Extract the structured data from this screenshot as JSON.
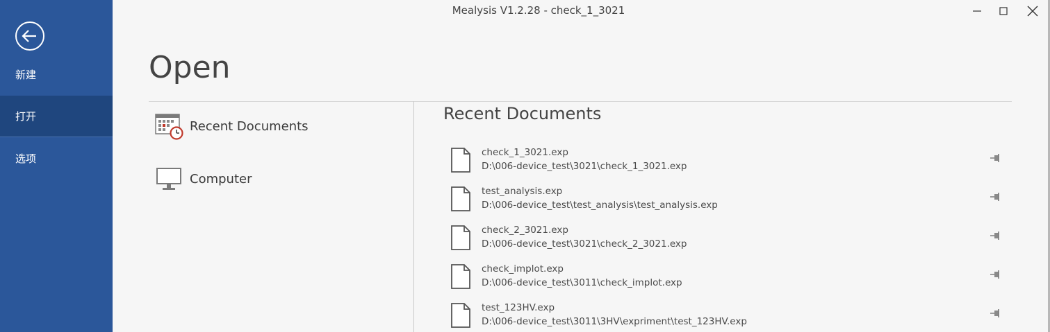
{
  "window": {
    "title": "Mealysis V1.2.28 - check_1_3021"
  },
  "sidebar": {
    "items": [
      {
        "label": "新建"
      },
      {
        "label": "打开"
      },
      {
        "label": "选项"
      }
    ]
  },
  "page": {
    "heading": "Open"
  },
  "places": [
    {
      "label": "Recent Documents",
      "icon": "recent-documents-icon"
    },
    {
      "label": "Computer",
      "icon": "computer-icon"
    }
  ],
  "recent": {
    "heading": "Recent Documents",
    "documents": [
      {
        "name": "check_1_3021.exp",
        "path": "D:\\006-device_test\\3021\\check_1_3021.exp"
      },
      {
        "name": "test_analysis.exp",
        "path": "D:\\006-device_test\\test_analysis\\test_analysis.exp"
      },
      {
        "name": "check_2_3021.exp",
        "path": "D:\\006-device_test\\3021\\check_2_3021.exp"
      },
      {
        "name": "check_implot.exp",
        "path": "D:\\006-device_test\\3011\\check_implot.exp"
      },
      {
        "name": "test_123HV.exp",
        "path": "D:\\006-device_test\\3011\\3HV\\expriment\\test_123HV.exp"
      }
    ]
  },
  "colors": {
    "sidebar": "#2b579a",
    "sidebar_active": "#1f467e",
    "background": "#f6f6f6",
    "accent_red": "#c0392b"
  }
}
